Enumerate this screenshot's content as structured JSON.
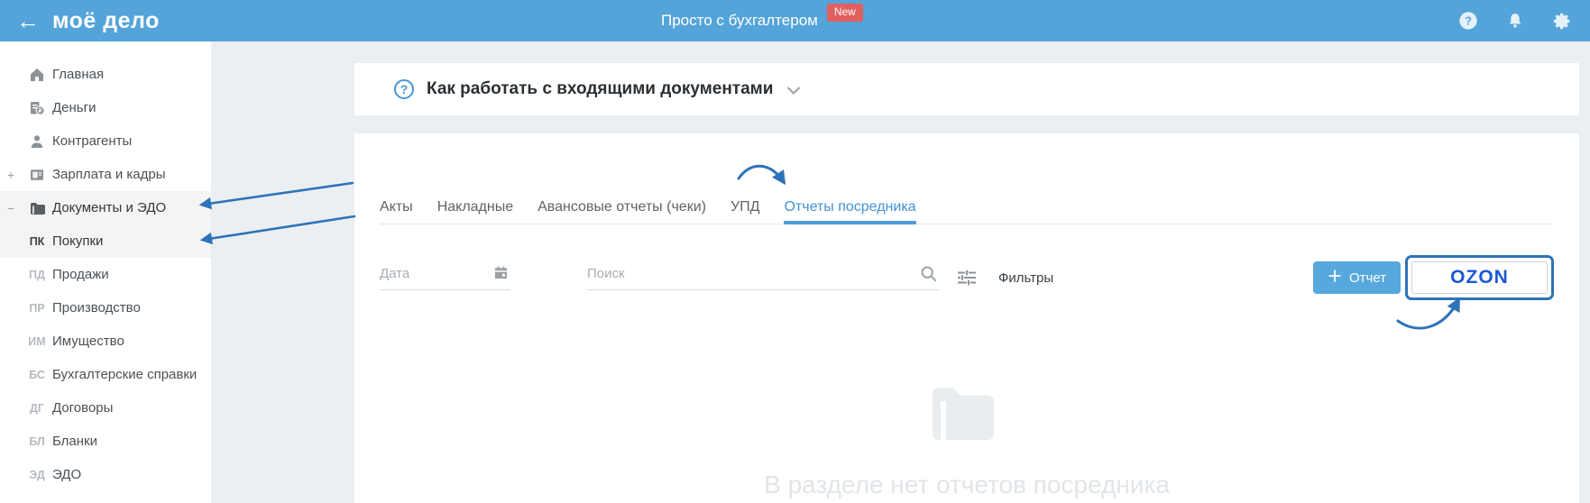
{
  "topbar": {
    "back_arrow": "←",
    "logo": "моё дело",
    "tagline": "Просто с бухгалтером",
    "new_badge": "New"
  },
  "sidebar": {
    "items": [
      {
        "label": "Главная",
        "icon": "home-icon"
      },
      {
        "label": "Деньги",
        "icon": "money-document-icon"
      },
      {
        "label": "Контрагенты",
        "icon": "person-icon"
      },
      {
        "label": "Зарплата и кадры",
        "icon": "id-card-icon",
        "expander": "+"
      },
      {
        "label": "Документы и ЭДО",
        "icon": "folder-icon",
        "expander": "−",
        "active": true
      },
      {
        "label": "Покупки",
        "prefix": "ПК",
        "active": true
      },
      {
        "label": "Продажи",
        "prefix": "ПД"
      },
      {
        "label": "Производство",
        "prefix": "ПР"
      },
      {
        "label": "Имущество",
        "prefix": "ИМ"
      },
      {
        "label": "Бухгалтерские справки",
        "prefix": "БС"
      },
      {
        "label": "Договоры",
        "prefix": "ДГ"
      },
      {
        "label": "Бланки",
        "prefix": "БЛ"
      },
      {
        "label": "ЭДО",
        "prefix": "ЭД"
      }
    ]
  },
  "help_banner": {
    "title": "Как работать с входящими документами"
  },
  "tabs": {
    "items": [
      {
        "label": "Акты"
      },
      {
        "label": "Накладные"
      },
      {
        "label": "Авансовые отчеты (чеки)"
      },
      {
        "label": "УПД"
      },
      {
        "label": "Отчеты посредника",
        "active": true
      }
    ]
  },
  "filters": {
    "date_placeholder": "Дата",
    "search_placeholder": "Поиск",
    "filters_label": "Фильтры"
  },
  "actions": {
    "report_button_label": "Отчет",
    "ozon_button_label": "OZON"
  },
  "empty_state": {
    "message": "В разделе нет отчетов посредника"
  },
  "colors": {
    "topbar_blue": "#54a4d9",
    "accent_blue": "#4292d4",
    "annotation_blue": "#2e73b8",
    "ozon_blue": "#1b58d6",
    "badge_red": "#e15f5f",
    "content_bg": "#eceff1"
  }
}
